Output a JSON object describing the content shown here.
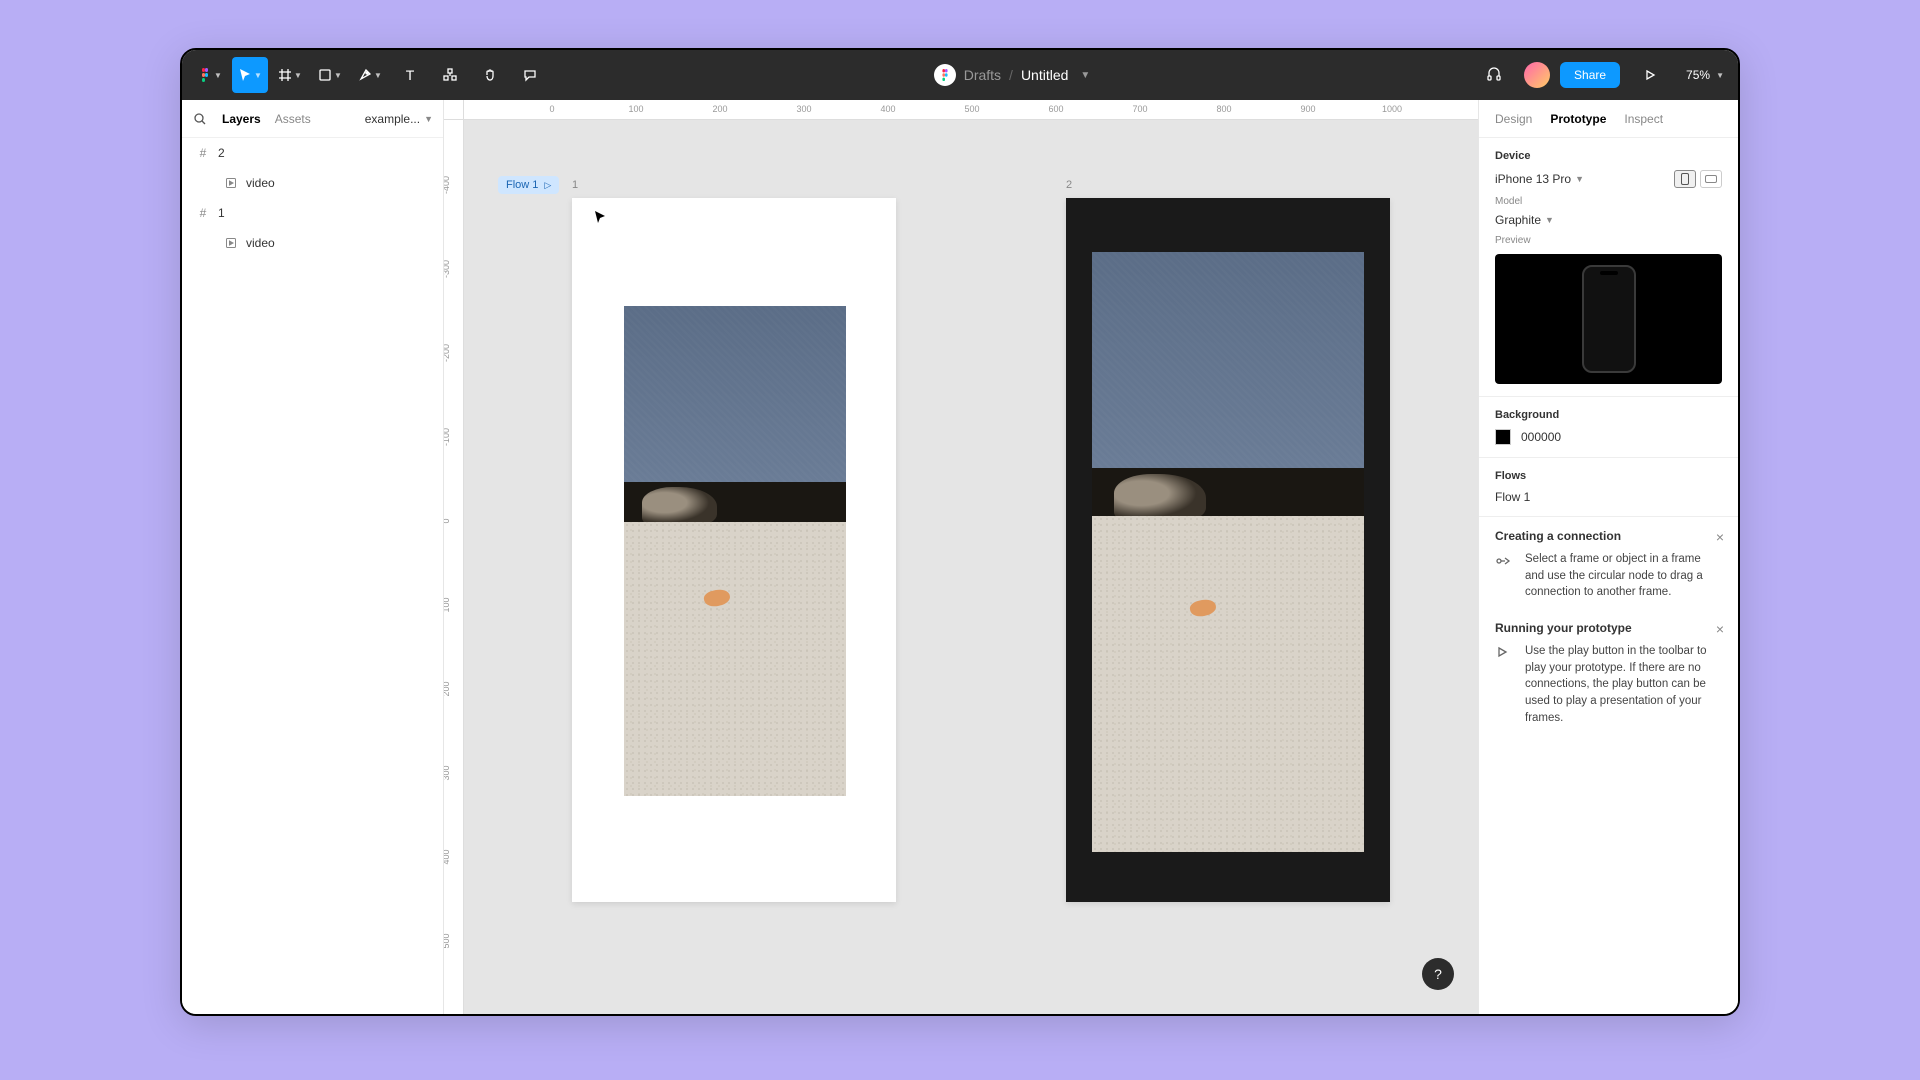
{
  "toolbar": {
    "breadcrumb_drafts": "Drafts",
    "breadcrumb_sep": "/",
    "file_title": "Untitled",
    "share_label": "Share",
    "zoom_label": "75%"
  },
  "left_panel": {
    "tabs": {
      "layers": "Layers",
      "assets": "Assets"
    },
    "page_selector": "example...",
    "layers": [
      {
        "type": "frame",
        "name": "2"
      },
      {
        "type": "video",
        "name": "video"
      },
      {
        "type": "frame",
        "name": "1"
      },
      {
        "type": "video",
        "name": "video"
      }
    ]
  },
  "ruler_top": [
    "0",
    "100",
    "200",
    "300",
    "400",
    "500",
    "600",
    "700",
    "800",
    "900",
    "1000"
  ],
  "ruler_left": [
    "-400",
    "-300",
    "-200",
    "-100",
    "0",
    "100",
    "200",
    "300",
    "400",
    "500"
  ],
  "canvas": {
    "flow_badge": "Flow 1",
    "frames": [
      {
        "label": "1"
      },
      {
        "label": "2"
      }
    ]
  },
  "right_panel": {
    "tabs": {
      "design": "Design",
      "prototype": "Prototype",
      "inspect": "Inspect"
    },
    "device_section_label": "Device",
    "device_name": "iPhone 13 Pro",
    "model_label": "Model",
    "model_value": "Graphite",
    "preview_label": "Preview",
    "background_label": "Background",
    "background_hex": "000000",
    "flows_label": "Flows",
    "flows_value": "Flow 1",
    "tip1_title": "Creating a connection",
    "tip1_body": "Select a frame or object in a frame and use the circular node to drag a connection to another frame.",
    "tip2_title": "Running your prototype",
    "tip2_body": "Use the play button in the toolbar to play your prototype. If there are no connections, the play button can be used to play a presentation of your frames."
  },
  "help_label": "?"
}
